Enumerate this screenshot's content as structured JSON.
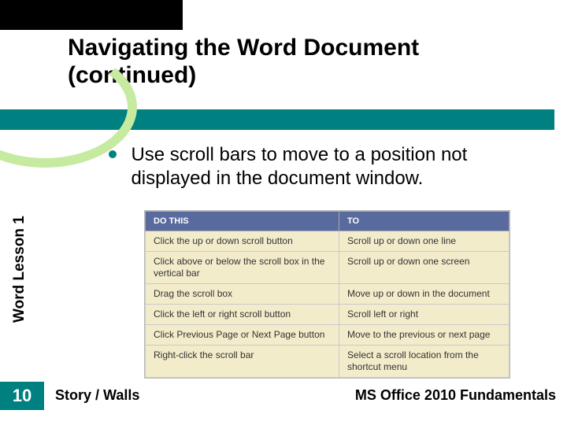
{
  "title": "Navigating the Word Document (continued)",
  "bullet": "Use scroll bars to move to a position not displayed in the document window.",
  "sidebar_label": "Word Lesson 1",
  "page_number": "10",
  "footer": {
    "left": "Story / Walls",
    "right": "MS Office 2010 Fundamentals"
  },
  "table": {
    "headers": [
      "DO THIS",
      "TO"
    ],
    "rows": [
      [
        "Click the up or down scroll button",
        "Scroll up or down one line"
      ],
      [
        "Click above or below the scroll box in the vertical bar",
        "Scroll up or down one screen"
      ],
      [
        "Drag the scroll box",
        "Move up or down in the document"
      ],
      [
        "Click the left or right scroll button",
        "Scroll left or right"
      ],
      [
        "Click Previous Page or Next Page button",
        "Move to the previous or next page"
      ],
      [
        "Right-click the scroll bar",
        "Select a scroll location from the shortcut menu"
      ]
    ]
  }
}
